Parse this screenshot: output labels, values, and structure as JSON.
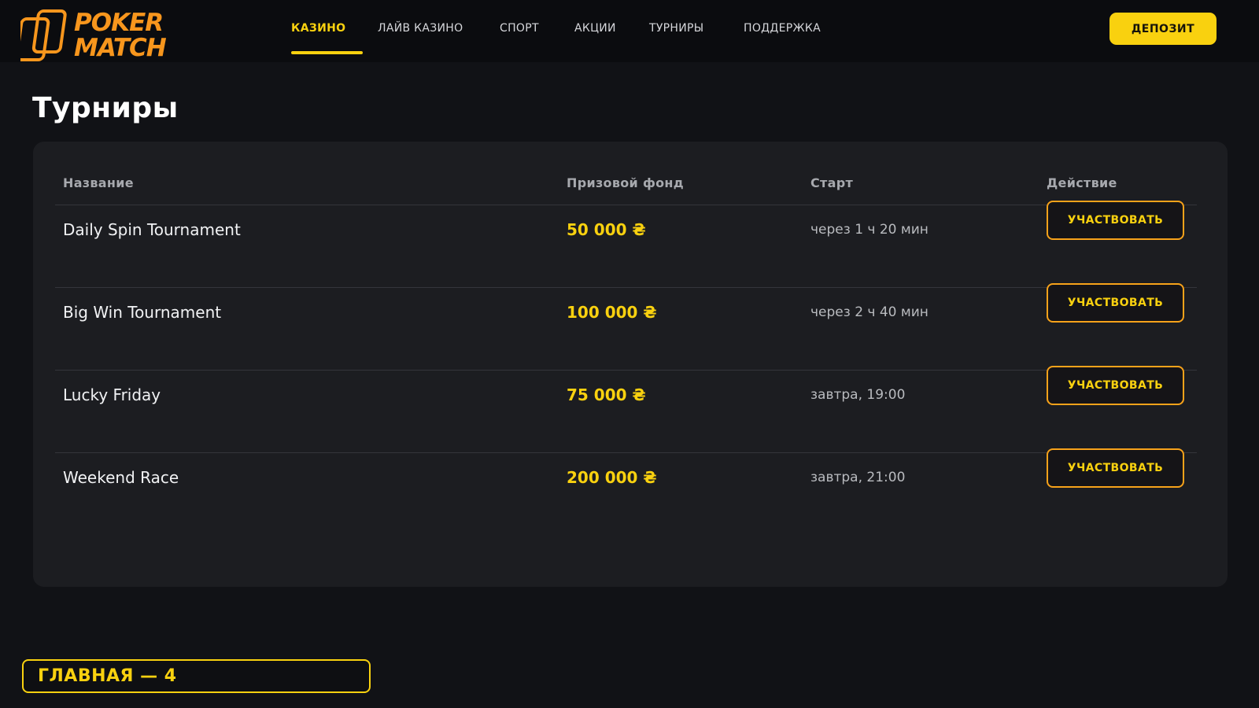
{
  "brand": {
    "line1": "POKER",
    "line2": "MATCH",
    "accent": "#f7961d"
  },
  "nav": {
    "items": [
      {
        "label": "КАЗИНО",
        "active": true
      },
      {
        "label": "ЛАЙВ КАЗИНО",
        "active": false
      },
      {
        "label": "СПОРТ",
        "active": false
      },
      {
        "label": "АКЦИИ",
        "active": false
      },
      {
        "label": "ТУРНИРЫ",
        "active": false
      },
      {
        "label": "ПОДДЕРЖКА",
        "active": false
      }
    ],
    "active_color": "#f9d10f"
  },
  "header": {
    "deposit_label": "ДЕПОЗИТ"
  },
  "page": {
    "title": "Турниры"
  },
  "table": {
    "columns": [
      "Название",
      "Призовой фонд",
      "Старт",
      "Действие"
    ],
    "rows": [
      {
        "name": "Daily Spin Tournament",
        "prize": "50 000 ₴",
        "start": "через 1 ч 20 мин",
        "action": "УЧАСТВОВАТЬ"
      },
      {
        "name": "Big Win Tournament",
        "prize": "100 000 ₴",
        "start": "через 2 ч 40 мин",
        "action": "УЧАСТВОВАТЬ"
      },
      {
        "name": "Lucky Friday",
        "prize": "75 000 ₴",
        "start": "завтра, 19:00",
        "action": "УЧАСТВОВАТЬ"
      },
      {
        "name": "Weekend Race",
        "prize": "200 000 ₴",
        "start": "завтра, 21:00",
        "action": "УЧАСТВОВАТЬ"
      }
    ]
  },
  "footer": {
    "label": "ГЛАВНАЯ — 4"
  },
  "colors": {
    "background": "#111216",
    "panel": "#1c1d21",
    "prize": "#f9d10f",
    "button_border": "#f7a21a"
  }
}
